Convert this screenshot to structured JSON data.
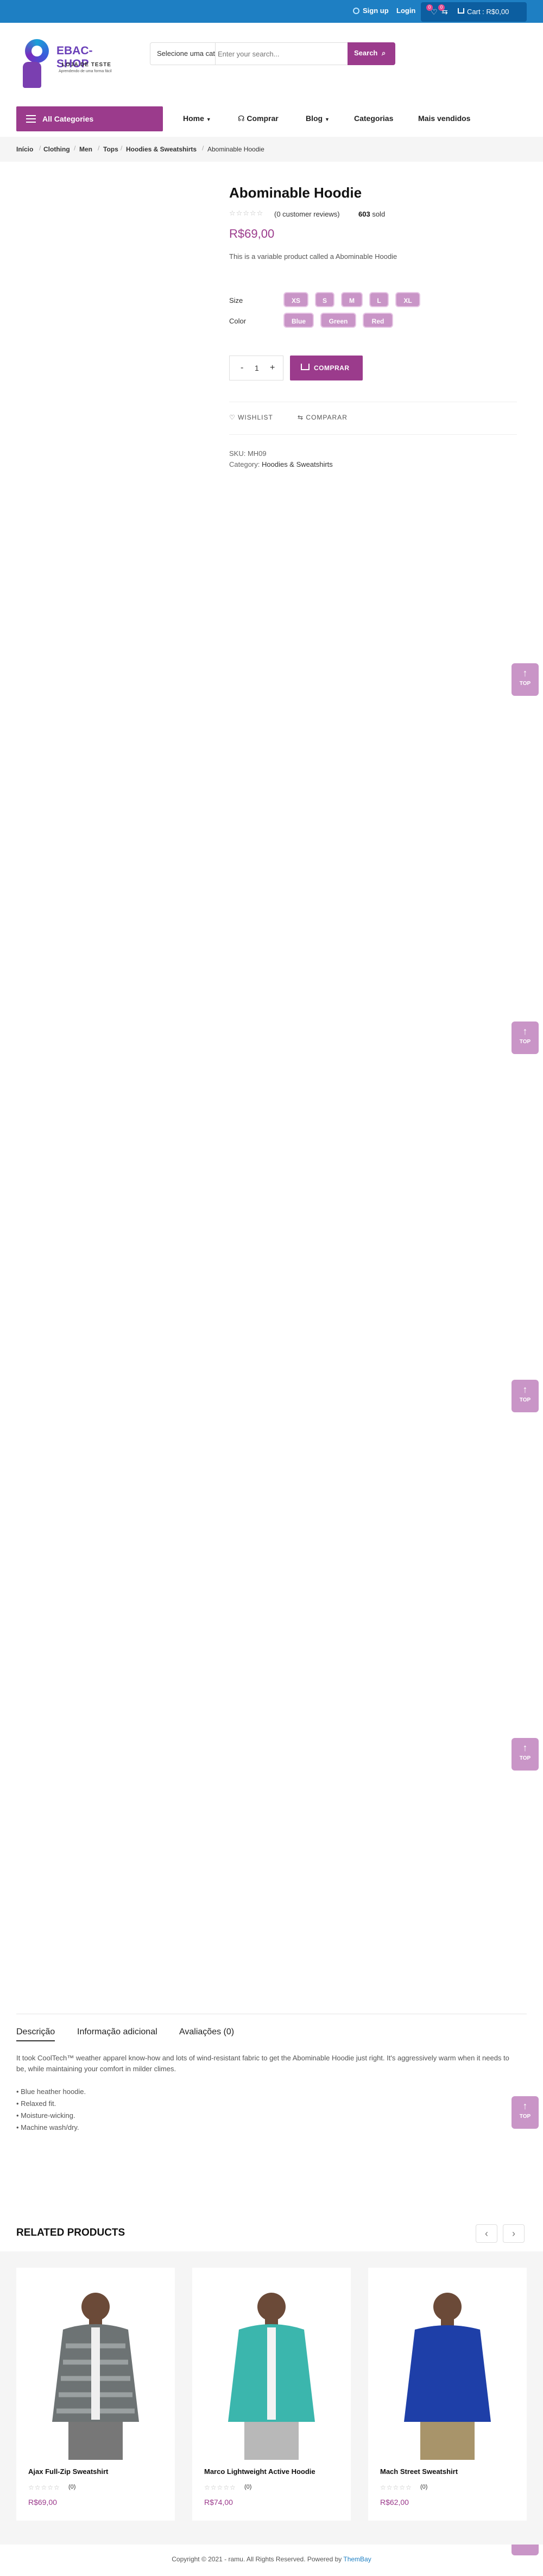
{
  "topbar": {
    "signup": "Sign up",
    "login": "Login",
    "wishlist_count": "0",
    "cart_count": "0",
    "cart_label": "Cart : R$0,00"
  },
  "header": {
    "brand": "EBAC-SHOP",
    "tagline": "LOJA DE TESTE",
    "tagline_sub": "Aprendendo de uma forma fácil",
    "category_select": "Selecione uma cat",
    "search_placeholder": "Enter your search...",
    "search_button": "Search"
  },
  "nav": {
    "all_categories": "All Categories",
    "items": [
      "Home",
      "Comprar",
      "Blog",
      "Categorias",
      "Mais vendidos"
    ]
  },
  "breadcrumb": [
    "Início",
    "Clothing",
    "Men",
    "Tops",
    "Hoodies & Sweatshirts",
    "Abominable Hoodie"
  ],
  "product": {
    "title": "Abominable Hoodie",
    "stars": "☆☆☆☆☆",
    "reviews": "(0 customer reviews)",
    "sold_count": "603",
    "sold_label": "sold",
    "price": "R$69,00",
    "short_description": "This is a variable product called a Abominable Hoodie",
    "size_label": "Size",
    "sizes": [
      "XS",
      "S",
      "M",
      "L",
      "XL"
    ],
    "color_label": "Color",
    "colors": [
      "Blue",
      "Green",
      "Red"
    ],
    "quantity": "1",
    "qty_minus": "-",
    "qty_plus": "+",
    "add_to_cart": "COMPRAR",
    "wishlist": "WISHLIST",
    "compare": "COMPARAR",
    "sku_label": "SKU:",
    "sku": "MH09",
    "category_label": "Category:",
    "category": "Hoodies & Sweatshirts"
  },
  "scroll_top": {
    "label": "TOP",
    "arrow": "↑"
  },
  "tabs": [
    "Descrição",
    "Informação adicional",
    "Avaliações (0)"
  ],
  "description": {
    "text": "It took CoolTech™ weather apparel know-how and lots of wind-resistant fabric to get the Abominable Hoodie just right. It's aggressively warm when it needs to be, while maintaining your comfort in milder climes.",
    "bullets": [
      "• Blue heather hoodie.",
      "• Relaxed fit.",
      "• Moisture-wicking.",
      "• Machine wash/dry."
    ]
  },
  "related": {
    "title": "RELATED PRODUCTS",
    "prev": "‹",
    "next": "›",
    "products": [
      {
        "name": "Ajax Full-Zip Sweatshirt",
        "stars": "☆☆☆☆☆",
        "count": "(0)",
        "price": "R$69,00",
        "color": "#6d7374"
      },
      {
        "name": "Marco Lightweight Active Hoodie",
        "stars": "☆☆☆☆☆",
        "count": "(0)",
        "price": "R$74,00",
        "color": "#3bb6ad"
      },
      {
        "name": "Mach Street Sweatshirt",
        "stars": "☆☆☆☆☆",
        "count": "(0)",
        "price": "R$62,00",
        "color": "#1e3fa8"
      }
    ]
  },
  "footer": {
    "copyright": "Copyright © 2021 - ramu. All Rights Reserved. Powered by",
    "powered_by": "ThemBay"
  },
  "colors": {
    "accent": "#9b3b8c",
    "topbar": "#1e7fc3",
    "swatch": "#c995c7"
  }
}
